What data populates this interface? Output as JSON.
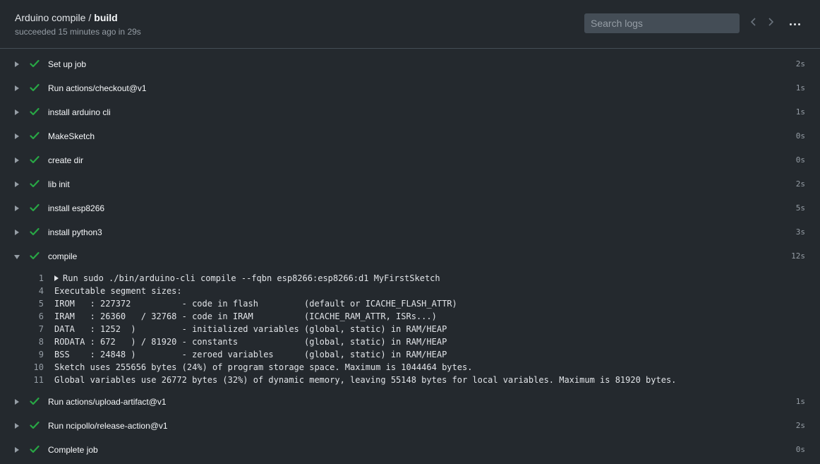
{
  "header": {
    "workflow": "Arduino compile",
    "separator": "/",
    "job": "build",
    "status": "succeeded 15 minutes ago in 29s",
    "search_placeholder": "Search logs",
    "prev_icon": "chevron-left-icon",
    "next_icon": "chevron-right-icon",
    "more_icon": "kebab-horizontal-icon"
  },
  "colors": {
    "background": "#24292e",
    "success": "#28a745",
    "muted": "#959da5"
  },
  "steps": [
    {
      "name": "Set up job",
      "duration": "2s"
    },
    {
      "name": "Run actions/checkout@v1",
      "duration": "1s"
    },
    {
      "name": "install arduino cli",
      "duration": "1s"
    },
    {
      "name": "MakeSketch",
      "duration": "0s"
    },
    {
      "name": "create dir",
      "duration": "0s"
    },
    {
      "name": "lib init",
      "duration": "2s"
    },
    {
      "name": "install esp8266",
      "duration": "5s"
    },
    {
      "name": "install python3",
      "duration": "3s"
    },
    {
      "name": "compile",
      "duration": "12s",
      "expanded": true
    },
    {
      "name": "Run actions/upload-artifact@v1",
      "duration": "1s"
    },
    {
      "name": "Run ncipollo/release-action@v1",
      "duration": "2s"
    },
    {
      "name": "Complete job",
      "duration": "0s"
    }
  ],
  "log": [
    {
      "n": "1",
      "text": "Run sudo ./bin/arduino-cli compile --fqbn esp8266:esp8266:d1 MyFirstSketch",
      "group": true
    },
    {
      "n": "4",
      "text": "Executable segment sizes:"
    },
    {
      "n": "5",
      "text": "IROM   : 227372          - code in flash         (default or ICACHE_FLASH_ATTR)"
    },
    {
      "n": "6",
      "text": "IRAM   : 26360   / 32768 - code in IRAM          (ICACHE_RAM_ATTR, ISRs...)"
    },
    {
      "n": "7",
      "text": "DATA   : 1252  )         - initialized variables (global, static) in RAM/HEAP"
    },
    {
      "n": "8",
      "text": "RODATA : 672   ) / 81920 - constants             (global, static) in RAM/HEAP"
    },
    {
      "n": "9",
      "text": "BSS    : 24848 )         - zeroed variables      (global, static) in RAM/HEAP"
    },
    {
      "n": "10",
      "text": "Sketch uses 255656 bytes (24%) of program storage space. Maximum is 1044464 bytes."
    },
    {
      "n": "11",
      "text": "Global variables use 26772 bytes (32%) of dynamic memory, leaving 55148 bytes for local variables. Maximum is 81920 bytes."
    }
  ]
}
